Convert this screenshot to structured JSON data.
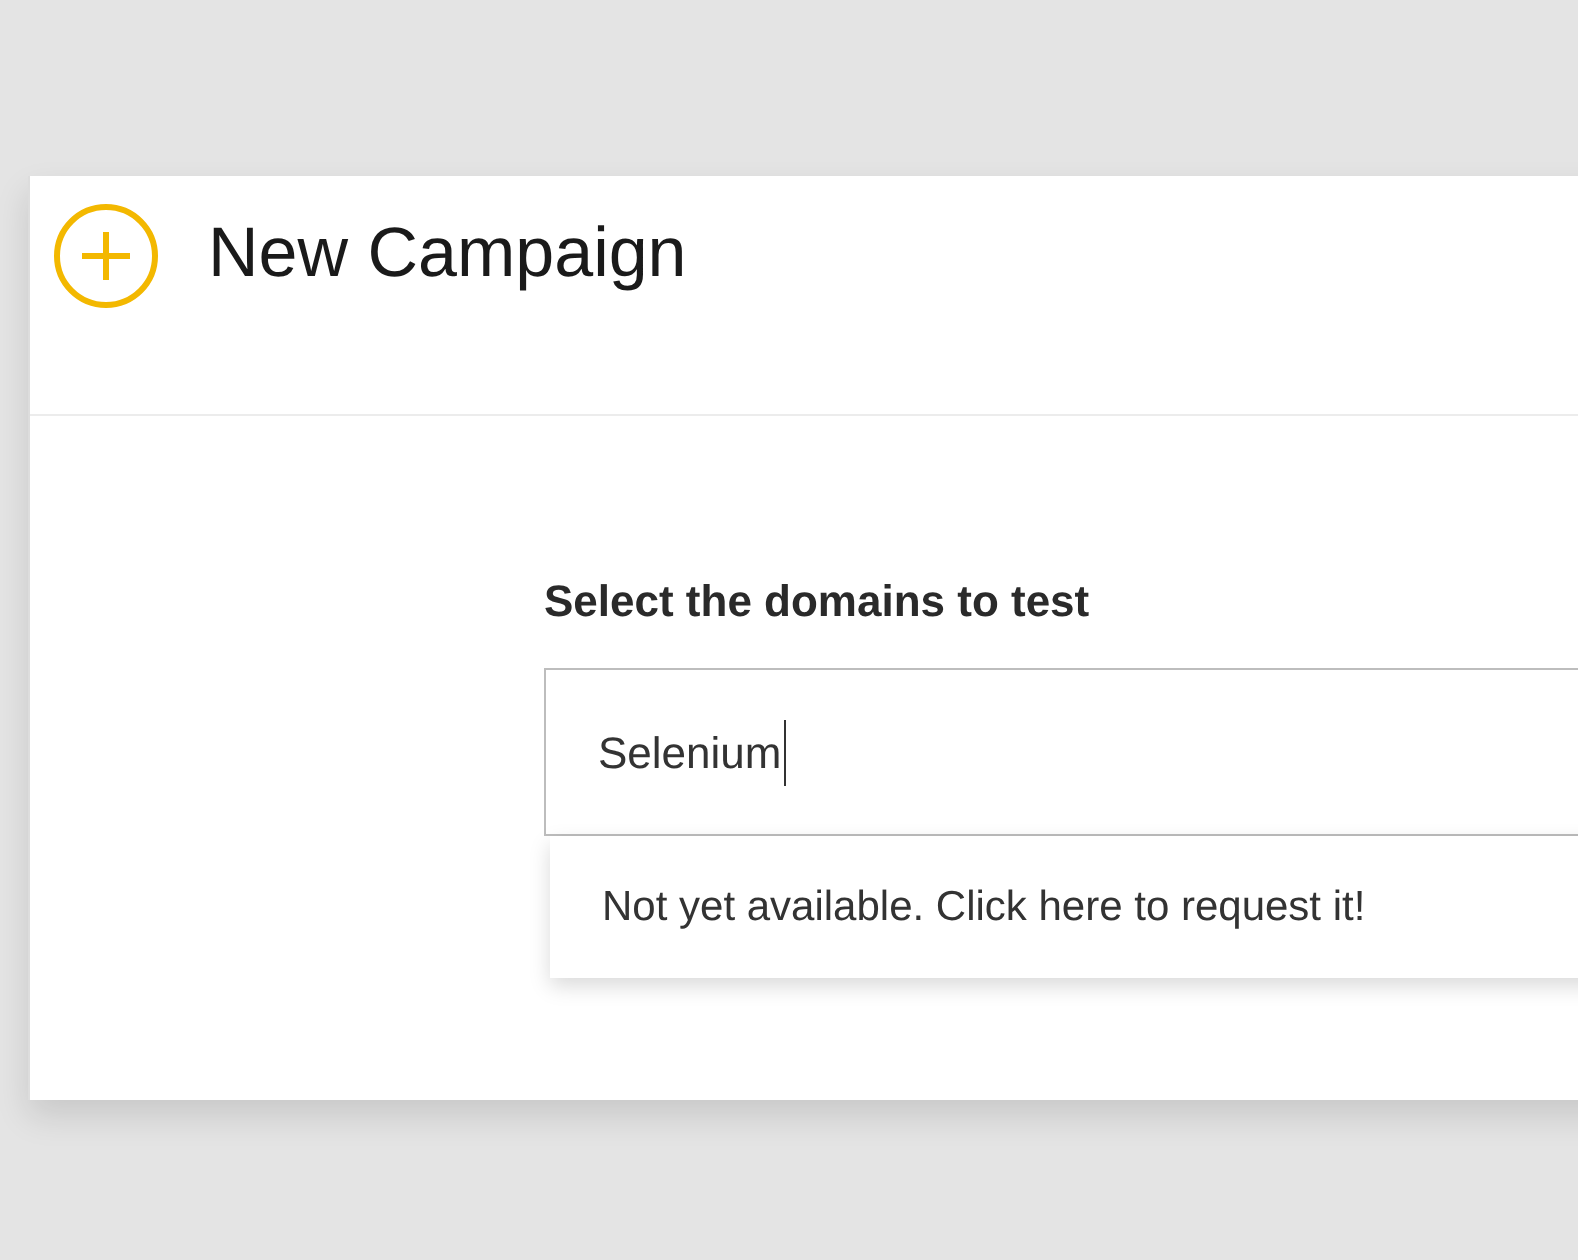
{
  "header": {
    "title": "New Campaign"
  },
  "domains": {
    "label": "Select the domains to test",
    "value": "Selenium",
    "suggestions": [
      "Not yet available. Click here to request it!"
    ]
  }
}
